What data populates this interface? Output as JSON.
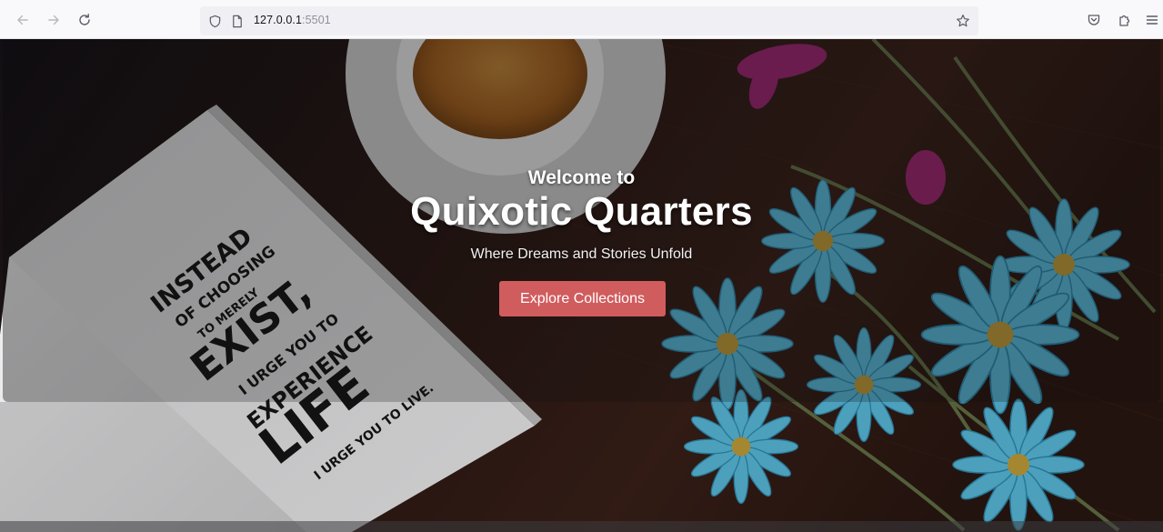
{
  "browser": {
    "url_host": "127.0.0.1",
    "url_port": ":5501",
    "icons": {
      "back": "arrow-left-icon",
      "forward": "arrow-right-icon",
      "reload": "reload-icon",
      "tracking": "shield-icon",
      "page": "page-icon",
      "bookmark": "star-icon",
      "pocket": "pocket-icon",
      "extensions": "puzzle-icon",
      "menu": "hamburger-menu-icon"
    }
  },
  "hero": {
    "welcome": "Welcome to",
    "title": "Quixotic Quarters",
    "tagline": "Where Dreams and Stories Unfold",
    "cta_label": "Explore Collections",
    "cta_color": "#d05c5e"
  },
  "background_image": {
    "book_lines": [
      "INSTEAD",
      "OF CHOOSING",
      "TO MERELY",
      "EXIST,",
      "I URGE YOU TO",
      "EXPERIENCE",
      "LIFE",
      "I URGE YOU TO LIVE."
    ]
  },
  "colors": {
    "toolbar_bg": "#f9f9fb",
    "urlbar_bg": "#f0f0f4",
    "wood": "#2a1a14",
    "flower_blue": "#4fb7d8",
    "flower_pink": "#b0287f"
  }
}
